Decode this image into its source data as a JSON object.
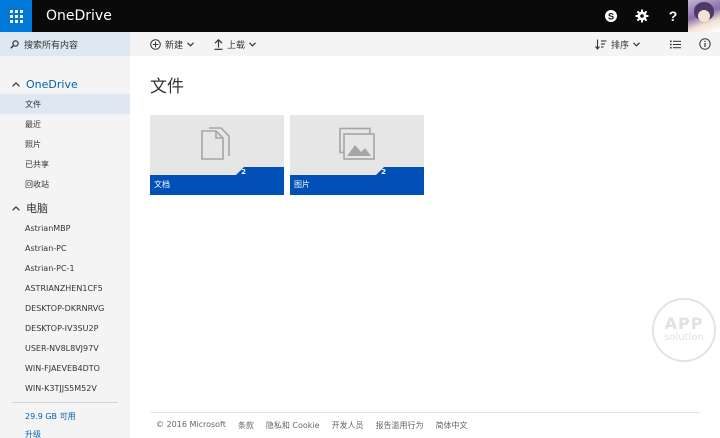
{
  "header": {
    "brand": "OneDrive",
    "icons": [
      "app-launcher-icon",
      "skype-icon",
      "gear-icon",
      "help-icon"
    ]
  },
  "search": {
    "label": "搜索所有内容"
  },
  "commands": {
    "new_label": "新建",
    "upload_label": "上载",
    "sort_label": "排序"
  },
  "sidebar": {
    "onedrive": {
      "heading": "OneDrive",
      "items": [
        {
          "label": "文件",
          "active": true
        },
        {
          "label": "最近"
        },
        {
          "label": "照片"
        },
        {
          "label": "已共享"
        },
        {
          "label": "回收站"
        }
      ]
    },
    "pcs": {
      "heading": "电脑",
      "items": [
        {
          "label": "AstrianMBP"
        },
        {
          "label": "Astrian-PC"
        },
        {
          "label": "Astrian-PC-1"
        },
        {
          "label": "ASTRIANZHEN1CF5"
        },
        {
          "label": "DESKTOP-DKRNRVG"
        },
        {
          "label": "DESKTOP-IV3SU2P"
        },
        {
          "label": "USER-NV8L8VJ97V"
        },
        {
          "label": "WIN-FJAEVEB4DTO"
        },
        {
          "label": "WIN-K3TJJS5M52V"
        }
      ]
    },
    "storage": "29.9 GB 可用",
    "upgrade": "升级"
  },
  "main": {
    "title": "文件",
    "folders": [
      {
        "name": "文档",
        "count": "2",
        "icon": "documents-folder-icon"
      },
      {
        "name": "图片",
        "count": "2",
        "icon": "pictures-folder-icon"
      }
    ]
  },
  "footer": {
    "links": [
      "© 2016 Microsoft",
      "条款",
      "隐私和 Cookie",
      "开发人员",
      "报告滥用行为",
      "简体中文"
    ]
  },
  "watermark": {
    "line1": "APP",
    "line2": "solution"
  },
  "colors": {
    "accent": "#0050b8",
    "topbar": "#0a0a0a",
    "launcher": "#0078d7",
    "selection": "#dde8f3"
  }
}
